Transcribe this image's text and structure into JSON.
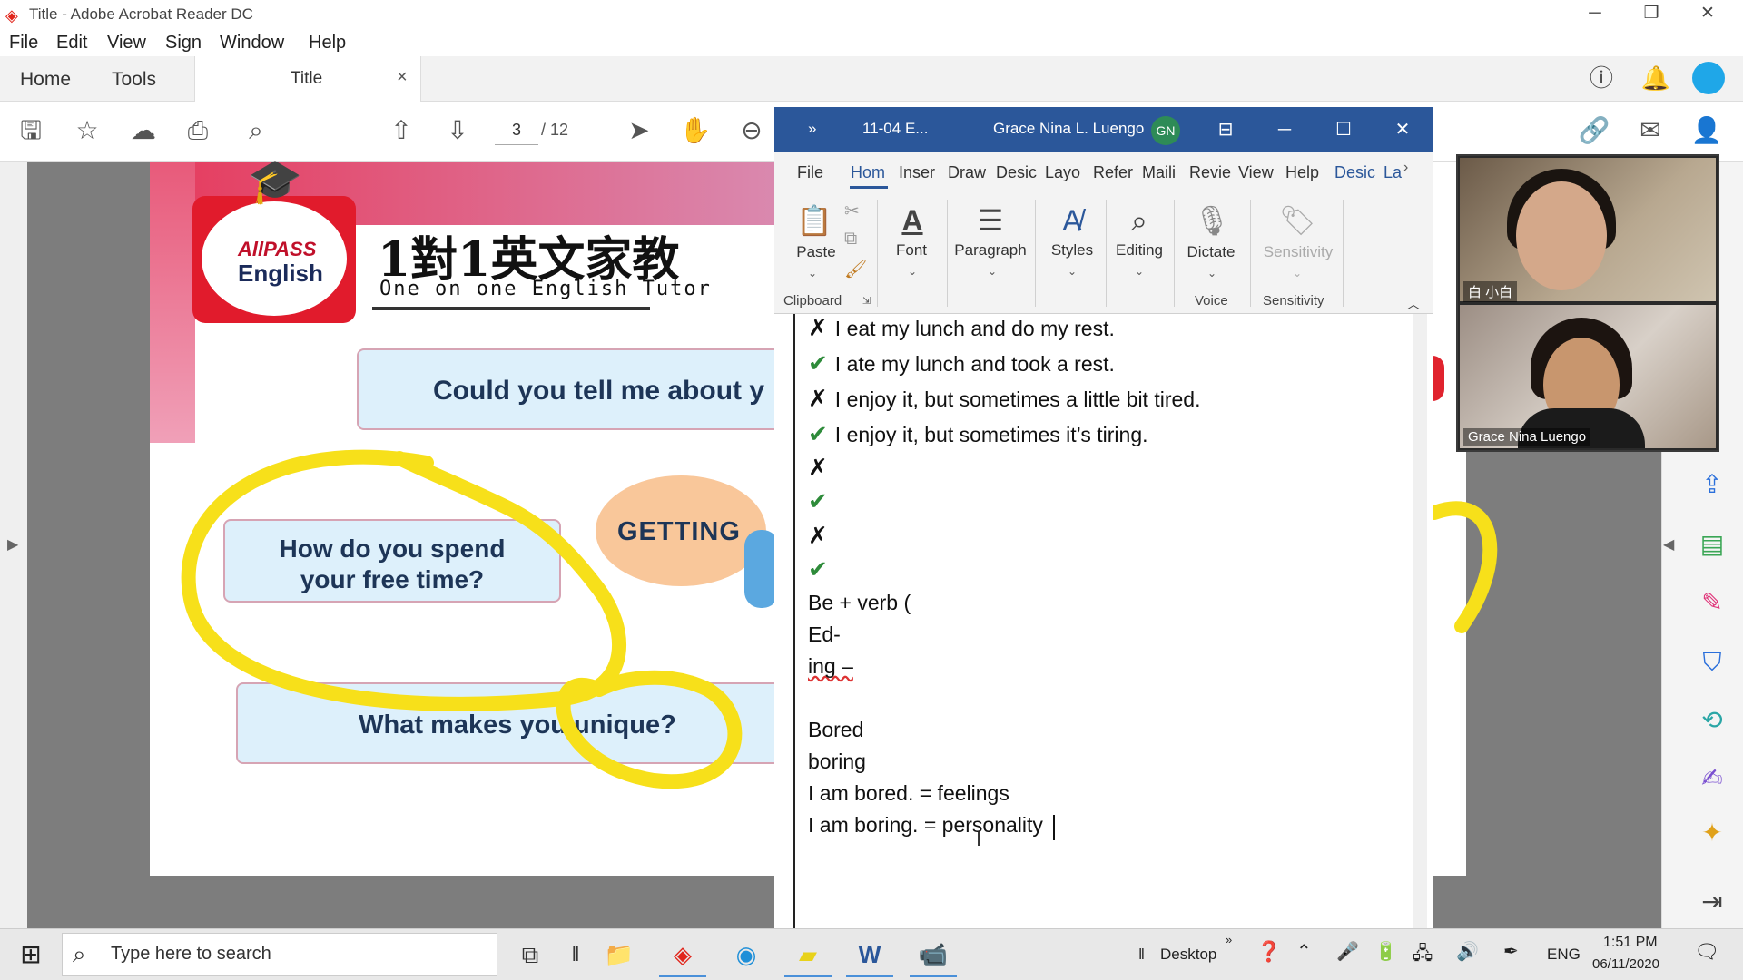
{
  "acrobat": {
    "window_title": "Title - Adobe Acrobat Reader DC",
    "menu": [
      "File",
      "Edit",
      "View",
      "Sign",
      "Window",
      "Help"
    ],
    "nav_tabs": {
      "home": "Home",
      "tools": "Tools"
    },
    "doc_tab": {
      "label": "Title",
      "close": "×"
    },
    "page_current": "3",
    "page_total": "/ 12"
  },
  "slide": {
    "logo_line1": "AllPASS",
    "logo_line2": "English",
    "title_cn": "1對1英文家教",
    "title_en": "One on one English Tutor",
    "q1": "Could you tell me about y",
    "q2_line1": "How do you spend",
    "q2_line2": "your free time?",
    "q3": "What makes you unique?",
    "bubble": "GETTING"
  },
  "word": {
    "title_chevron": "»",
    "doc_name": "11-04 E...",
    "user_name": "Grace Nina L. Luengo",
    "user_initials": "GN",
    "ribbon_tabs": [
      "File",
      "Hom",
      "Inser",
      "Draw",
      "Desic",
      "Layo",
      "Refer",
      "Maili",
      "Revie",
      "View",
      "Help",
      "Desic",
      "La"
    ],
    "ribbon_groups": {
      "paste": "Paste",
      "clipboard": "Clipboard",
      "font": "Font",
      "paragraph": "Paragraph",
      "styles": "Styles",
      "editing": "Editing",
      "dictate": "Dictate",
      "voice": "Voice",
      "sensitivity_btn": "Sensitivity",
      "sensitivity": "Sensitivity"
    },
    "lines": [
      {
        "mark": "x",
        "text": "I eat my lunch and do my rest."
      },
      {
        "mark": "check",
        "text": "I ate my lunch and took a rest."
      },
      {
        "mark": "x",
        "text": "I enjoy it, but sometimes a little bit tired."
      },
      {
        "mark": "check",
        "text": "I enjoy it, but sometimes it’s tiring."
      },
      {
        "mark": "x",
        "text": ""
      },
      {
        "mark": "check",
        "text": ""
      },
      {
        "mark": "x",
        "text": ""
      },
      {
        "mark": "check",
        "text": ""
      }
    ],
    "text_lines": [
      "Be + verb (",
      "Ed-",
      "ing –",
      "",
      "Bored",
      "boring",
      "I am bored. = feelings",
      "I am boring. = personality"
    ]
  },
  "zoom": {
    "participant_1": "白 小白",
    "participant_2": "Grace Nina Luengo"
  },
  "taskbar": {
    "search_placeholder": "Type here to search",
    "desktop_label": "Desktop",
    "chevron": "»",
    "language": "ENG",
    "time": "1:51 PM",
    "date": "06/11/2020"
  },
  "colors": {
    "word_blue": "#2b579a",
    "highlight_yellow": "#f7e01a",
    "check_green": "#2e8b3a",
    "acrobat_red": "#e1251b"
  }
}
